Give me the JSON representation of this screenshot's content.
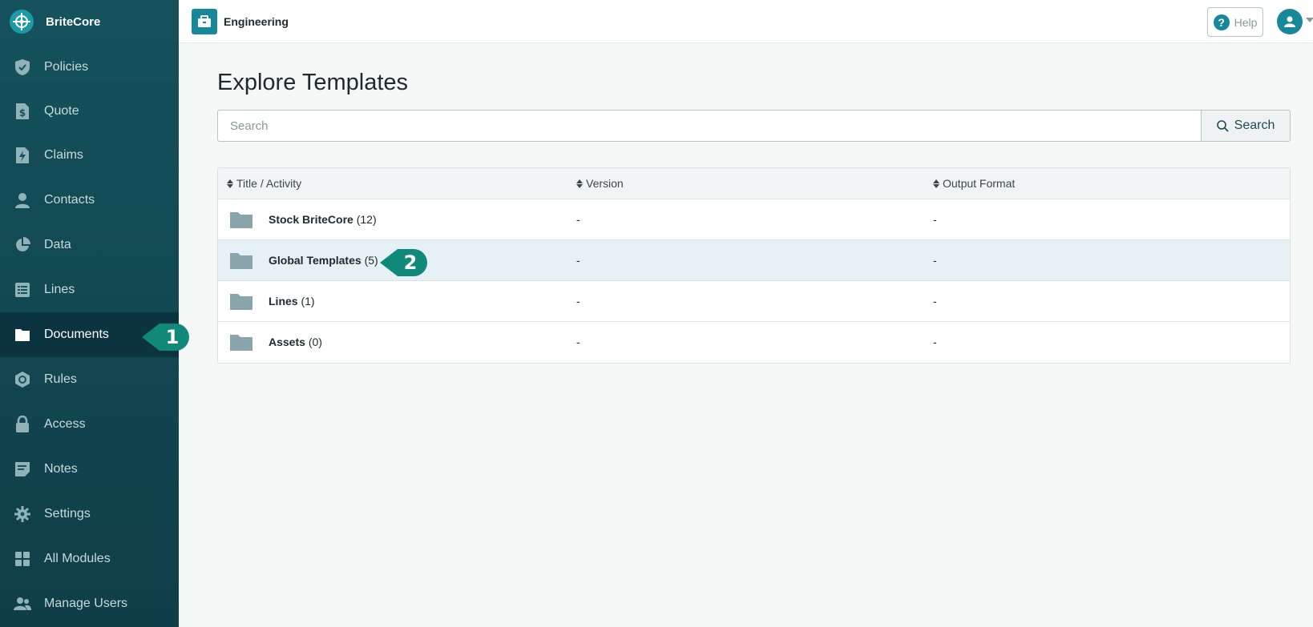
{
  "brand": {
    "name": "BriteCore"
  },
  "sidebar": {
    "items": [
      {
        "label": "Policies",
        "icon": "shield-check-icon"
      },
      {
        "label": "Quote",
        "icon": "dollar-document-icon"
      },
      {
        "label": "Claims",
        "icon": "bolt-document-icon"
      },
      {
        "label": "Contacts",
        "icon": "person-icon"
      },
      {
        "label": "Data",
        "icon": "pie-chart-icon"
      },
      {
        "label": "Lines",
        "icon": "list-icon"
      },
      {
        "label": "Documents",
        "icon": "folder-icon",
        "active": true
      },
      {
        "label": "Rules",
        "icon": "gear-badge-icon"
      },
      {
        "label": "Access",
        "icon": "lock-icon"
      },
      {
        "label": "Notes",
        "icon": "note-icon"
      },
      {
        "label": "Settings",
        "icon": "gear-icon"
      },
      {
        "label": "All Modules",
        "icon": "grid-icon"
      },
      {
        "label": "Manage Users",
        "icon": "users-icon"
      }
    ]
  },
  "callouts": {
    "one": "1",
    "two": "2",
    "color": "#11897a"
  },
  "topbar": {
    "org_name": "Engineering",
    "help_label": "Help"
  },
  "main": {
    "title": "Explore Templates",
    "search": {
      "placeholder": "Search",
      "value": "",
      "button_label": "Search"
    },
    "table": {
      "headers": {
        "title": "Title / Activity",
        "version": "Version",
        "format": "Output Format"
      },
      "rows": [
        {
          "name": "Stock BriteCore",
          "count": "(12)",
          "version": "-",
          "format": "-"
        },
        {
          "name": "Global Templates",
          "count": "(5)",
          "version": "-",
          "format": "-",
          "highlighted": true
        },
        {
          "name": "Lines",
          "count": "(1)",
          "version": "-",
          "format": "-"
        },
        {
          "name": "Assets",
          "count": "(0)",
          "version": "-",
          "format": "-"
        }
      ]
    }
  },
  "colors": {
    "accent": "#17879a",
    "sidebar": "#15525c",
    "highlight_row": "#e5f1f4"
  }
}
